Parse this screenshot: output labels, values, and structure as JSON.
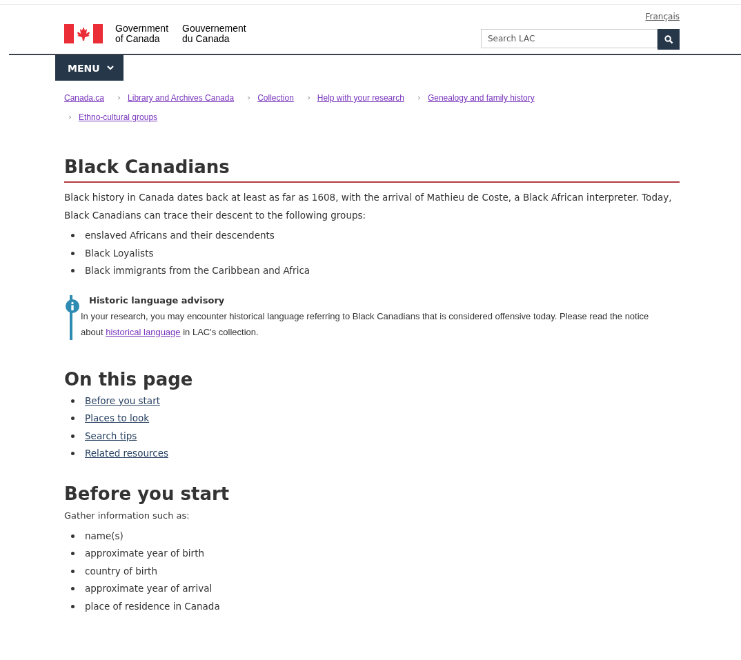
{
  "header": {
    "language_link": "Français",
    "signature": {
      "english": [
        "Government",
        "of Canada"
      ],
      "french": [
        "Gouvernement",
        "du Canada"
      ]
    },
    "search": {
      "placeholder": "Search LAC"
    }
  },
  "menu_button": "MENU",
  "breadcrumbs": [
    "Canada.ca",
    "Library and Archives Canada",
    "Collection",
    "Help with your research",
    "Genealogy and family history",
    "Ethno-cultural groups"
  ],
  "title": "Black Canadians",
  "intro": "Black history in Canada dates back at least as far as 1608, with the arrival of Mathieu de Coste, a Black African interpreter. Today, Black Canadians can trace their descent to the following groups:",
  "groups": [
    "enslaved Africans and their descendents",
    "Black Loyalists",
    "Black immigrants from the Caribbean and Africa"
  ],
  "advisory": {
    "title": "Historic language advisory",
    "text_before": "In your research, you may encounter historical language referring to Black Canadians that is considered offensive today. Please read the notice about ",
    "link": "historical language",
    "text_after": " in LAC's collection."
  },
  "on_this_page": {
    "heading": "On this page",
    "links": [
      "Before you start",
      "Places to look",
      "Search tips",
      "Related resources"
    ]
  },
  "before_you_start": {
    "heading": "Before you start",
    "intro": "Gather information such as:",
    "items": [
      "name(s)",
      "approximate year of birth",
      "country of birth",
      "approximate year of arrival",
      "place of residence in Canada"
    ]
  }
}
